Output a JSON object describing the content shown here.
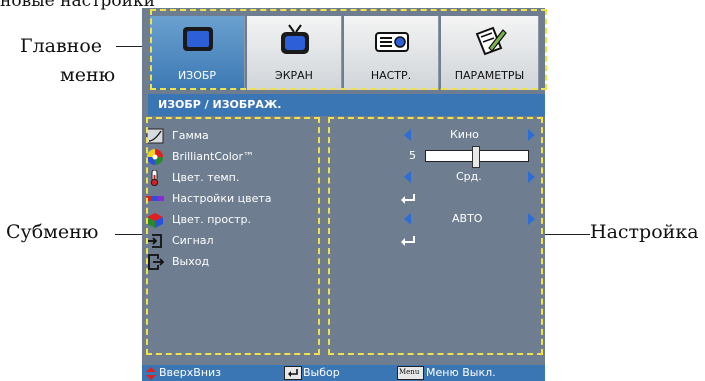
{
  "captions": {
    "top": "новые настройки",
    "main_menu_line1": "Главное",
    "main_menu_line2": "меню",
    "submenu": "Субменю",
    "setting": "Настройка"
  },
  "tabs": [
    {
      "label": "ИЗОБР",
      "icon": "monitor-icon",
      "active": true
    },
    {
      "label": "ЭКРАН",
      "icon": "tv-icon",
      "active": false
    },
    {
      "label": "НАСТР.",
      "icon": "projector-icon",
      "active": false
    },
    {
      "label": "ПАРАМЕТРЫ",
      "icon": "notepad-pencil-icon",
      "active": false
    }
  ],
  "title": "ИЗОБР / ИЗОБРАЖ.",
  "items": [
    {
      "label": "Гамма",
      "icon": "gamma-icon"
    },
    {
      "label": "BrilliantColor™",
      "icon": "color-wheel-icon"
    },
    {
      "label": "Цвет. темп.",
      "icon": "thermometer-icon"
    },
    {
      "label": "Настройки цвета",
      "icon": "color-bar-icon"
    },
    {
      "label": "Цвет. простр.",
      "icon": "color-cube-icon"
    },
    {
      "label": "Сигнал",
      "icon": "signal-input-icon"
    },
    {
      "label": "Выход",
      "icon": "exit-icon"
    }
  ],
  "settings": {
    "gamma": "Кино",
    "brilliant_value": "5",
    "brilliant_level": 0.5,
    "color_temp": "Срд.",
    "color_space": "АВТО"
  },
  "status": {
    "updown": "ВверхВниз",
    "select": "Выбор",
    "menu_key": "Menu",
    "menu_off": "Меню Выкл."
  },
  "colors": {
    "panel": "#6e7e90",
    "accent": "#3b76b4",
    "dash": "#f0e34a",
    "arrow": "#2c6dd6"
  }
}
